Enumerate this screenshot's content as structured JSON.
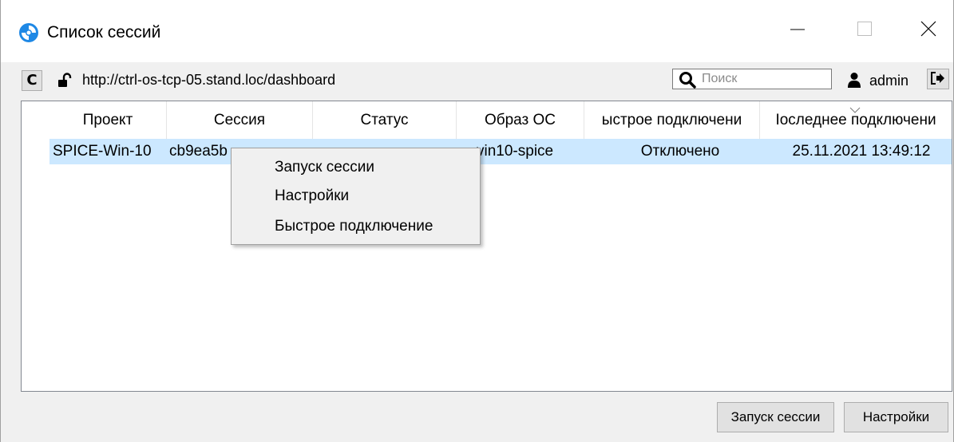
{
  "window": {
    "title": "Список сессий",
    "icons": {
      "app": "app-logo-icon",
      "minimize": "minimize-icon",
      "maximize": "maximize-icon",
      "close": "close-icon"
    }
  },
  "toolbar": {
    "refresh_label": "C",
    "url": "http://ctrl-os-tcp-05.stand.loc/dashboard",
    "search_placeholder": "Поиск",
    "search_value": "",
    "username": "admin",
    "icons": {
      "lock": "unlocked-padlock-icon",
      "search": "search-icon",
      "user": "user-icon",
      "logout": "logout-icon"
    }
  },
  "table": {
    "columns": [
      "Проект",
      "Сессия",
      "Статус",
      "Образ ОС",
      "ыстрое подключени",
      "Іоследнее подключени"
    ],
    "rows": [
      [
        "SPICE-Win-10",
        "cb9ea5b",
        "",
        "vin10-spice",
        "Отключено",
        "25.11.2021 13:49:12"
      ]
    ],
    "selected_row": 0
  },
  "context_menu": {
    "items": [
      "Запуск сессии",
      "Настройки",
      "Быстрое подключение"
    ]
  },
  "buttons": {
    "start_session": "Запуск сессии",
    "settings": "Настройки"
  },
  "colors": {
    "selection": "#cce8ff",
    "window_bg": "#f0f0f0",
    "app_icon_blue": "#1e88e5"
  }
}
